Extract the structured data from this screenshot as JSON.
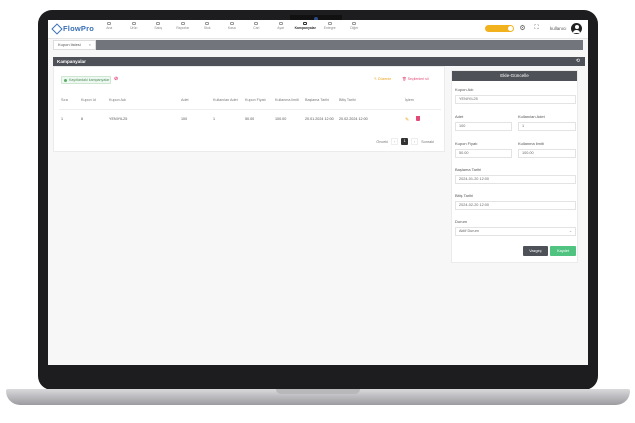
{
  "app": {
    "logo_text": "FlowPro",
    "user_name": "kullanıcı"
  },
  "nav": [
    {
      "label": "Ana"
    },
    {
      "label": "Ürün"
    },
    {
      "label": "Satış"
    },
    {
      "label": "Raporlar"
    },
    {
      "label": "Stok"
    },
    {
      "label": "Kasa"
    },
    {
      "label": "Cari"
    },
    {
      "label": "Ayar"
    },
    {
      "label": "Kampanyalar",
      "active": true
    },
    {
      "label": "Entegre"
    },
    {
      "label": "Diğer"
    }
  ],
  "tabs": [
    {
      "label": "Kupon listesi"
    }
  ],
  "page": {
    "title": "Kampanyalar"
  },
  "list": {
    "filter_chip": "Kayıtlardaki kampanyalar",
    "edit_label": "Düzenle",
    "delete_label": "Seçilenleri sil",
    "columns": [
      "Sıra",
      "Kupon Id",
      "Kupon Adı",
      "Adet",
      "Kullanılan Adet",
      "Kupon Fiyatı",
      "Kullanma limiti",
      "Başlama Tarihi",
      "Bitiş Tarihi",
      "İşlem"
    ],
    "rows": [
      {
        "sira": "1",
        "kupon_id": "8",
        "kupon_adi": "YENIYIL25",
        "adet": "100",
        "kullanilan": "1",
        "fiyat": "50.00",
        "limit": "100.00",
        "baslama": "20.01.2024 12:00",
        "bitis": "20.02.2024 12:00"
      }
    ],
    "pager": {
      "prev": "Önceki",
      "current": "1",
      "next": "Sonraki"
    }
  },
  "form": {
    "title": "Ekle-Güncelle",
    "kupon_adi_label": "Kupon Adı",
    "kupon_adi_value": "YENIYIL25",
    "adet_label": "Adet",
    "adet_value": "100",
    "kullanilan_label": "Kullanılan Adet",
    "kullanilan_value": "1",
    "fiyat_label": "Kupon Fiyatı",
    "fiyat_value": "50.00",
    "limit_label": "Kullanma limiti",
    "limit_value": "100.00",
    "baslama_label": "Başlama Tarihi",
    "baslama_value": "2024-01-20 12:00",
    "bitis_label": "Bitiş Tarihi",
    "bitis_value": "2024-02-20 12:00",
    "durum_label": "Durum",
    "durum_value": "Aktif Durum",
    "cancel_label": "Vazgeç",
    "save_label": "Kaydet"
  },
  "colors": {
    "accent": "#3a6fb5",
    "toggle": "#f2b21e",
    "save": "#4fc37f",
    "delete": "#e24b78",
    "header": "#4e5158"
  }
}
